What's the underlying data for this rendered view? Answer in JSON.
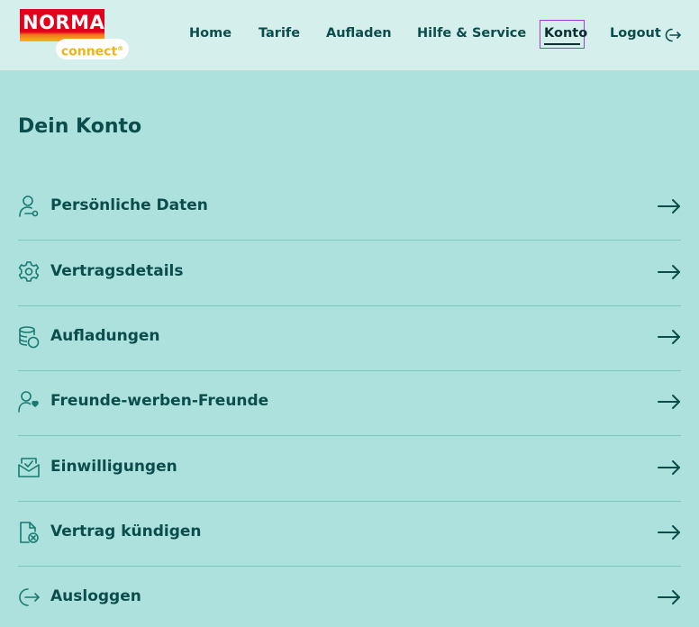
{
  "header": {
    "logo_text": "NORMA",
    "logo_sub": "connect",
    "logo_reg": "®",
    "nav": [
      "Home",
      "Tarife",
      "Aufladen",
      "Hilfe & Service",
      "Konto",
      "Logout"
    ]
  },
  "page": {
    "title": "Dein Konto"
  },
  "menu": [
    {
      "label": "Persönliche Daten",
      "icon": "user-key-icon"
    },
    {
      "label": "Vertragsdetails",
      "icon": "gear-icon"
    },
    {
      "label": "Aufladungen",
      "icon": "coins-icon"
    },
    {
      "label": "Freunde-werben-Freunde",
      "icon": "user-heart-icon"
    },
    {
      "label": "Einwilligungen",
      "icon": "envelope-check-icon"
    },
    {
      "label": "Vertrag kündigen",
      "icon": "document-cancel-icon"
    },
    {
      "label": "Ausloggen",
      "icon": "logout-icon"
    }
  ],
  "colors": {
    "background": "#ade1dd",
    "header": "#d5efed",
    "text": "#0b4d4d",
    "active_outline": "#9b3fcf",
    "brand_red": "#e2001a"
  }
}
